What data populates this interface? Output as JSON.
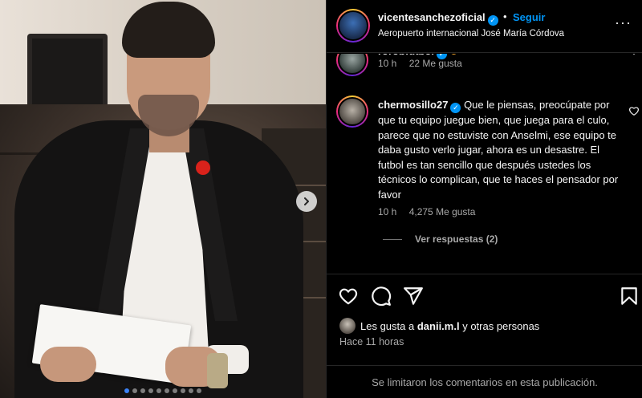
{
  "post": {
    "author": "vicentesanchezoficial",
    "separator": "•",
    "follow_label": "Seguir",
    "location": "Aeropuerto internacional José María Córdova",
    "photo_count": 10,
    "active_photo_index": 0
  },
  "comments": [
    {
      "user": "rorobfutbol",
      "text": "",
      "time": "10 h",
      "likes": "22 Me gusta"
    },
    {
      "user": "chermosillo27",
      "text": "Que le piensas, preocúpate por que tu equipo juegue bien, que juega para el culo, parece que no estuviste con Anselmi, ese equipo te daba gusto verlo jugar, ahora es un desastre. El futbol es tan sencillo que después ustedes los técnicos lo complican, que te haces el pensador por favor",
      "time": "10 h",
      "likes": "4,275 Me gusta",
      "replies_label": "Ver respuestas (2)"
    }
  ],
  "likes_summary": {
    "prefix": "Les gusta a ",
    "user": "danii.m.l",
    "suffix": " y otras personas"
  },
  "timestamp": "Hace 11 horas",
  "footer_notice": "Se limitaron los comentarios en esta publicación.",
  "colors": {
    "accent_blue": "#0095f6",
    "background": "#000000",
    "secondary_text": "#a8a8a8"
  },
  "icons": [
    "chevron-right-icon",
    "verified-icon",
    "more-icon",
    "heart-icon",
    "comment-icon",
    "share-icon",
    "bookmark-icon"
  ]
}
